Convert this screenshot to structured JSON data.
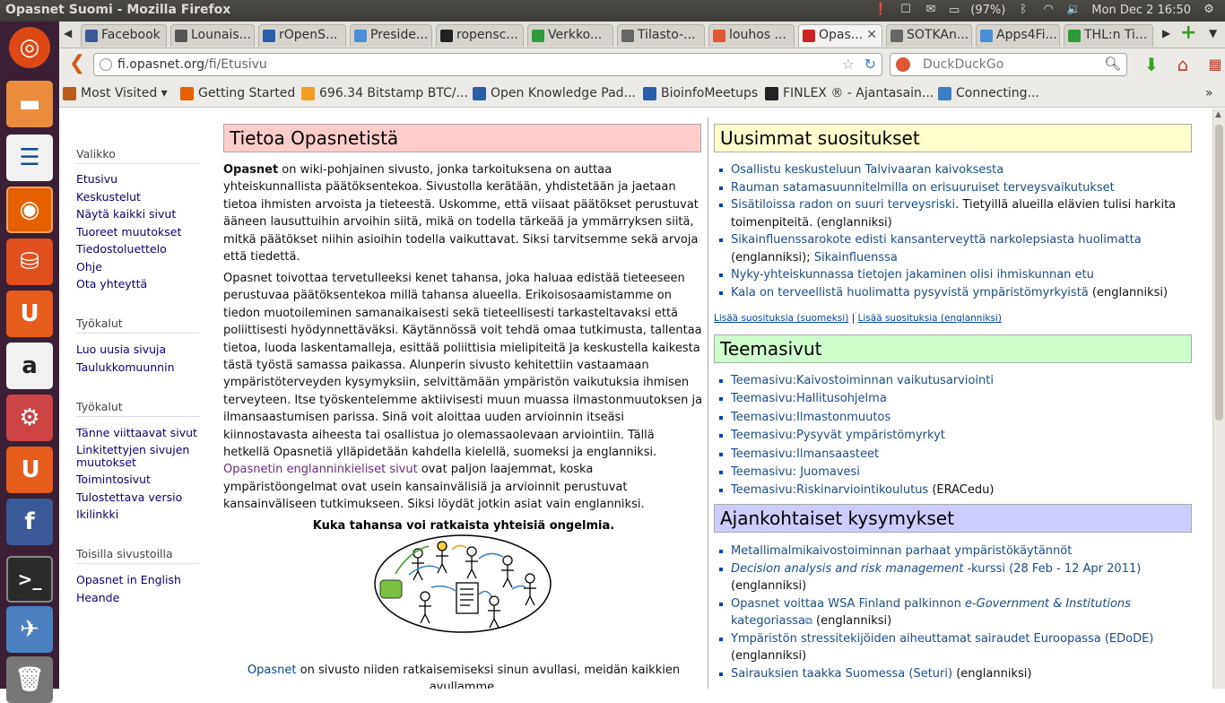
{
  "window": {
    "title": "Opasnet Suomi - Mozilla Firefox",
    "battery": "(97%)",
    "datetime": "Mon Dec 2  16:50"
  },
  "tabs": [
    {
      "label": "Facebook",
      "color": "#3b5998"
    },
    {
      "label": "Lounais...",
      "color": "#555555"
    },
    {
      "label": "rOpenS...",
      "color": "#2a5fa8"
    },
    {
      "label": "Preside...",
      "color": "#4a8fd6"
    },
    {
      "label": "ropensc...",
      "color": "#222222"
    },
    {
      "label": "Verkko...",
      "color": "#2f9a3a"
    },
    {
      "label": "Tilasto-...",
      "color": "#666666"
    },
    {
      "label": "louhos ...",
      "color": "#de5833"
    },
    {
      "label": "Opas...",
      "color": "#cc2222",
      "active": true
    },
    {
      "label": "SOTKAn...",
      "color": "#666666"
    },
    {
      "label": "Apps4Fi...",
      "color": "#4a8fd6"
    },
    {
      "label": "THL:n Ti...",
      "color": "#2f9a3a"
    }
  ],
  "navbar": {
    "url_host": "fi.opasnet.org",
    "url_path": "/fi/Etusivu",
    "search_placeholder": "DuckDuckGo"
  },
  "bookmarks": [
    {
      "label": "Most Visited ▾",
      "color": "#b85c1f"
    },
    {
      "label": "Getting Started",
      "color": "#e66000"
    },
    {
      "label": "696.34 Bitstamp BTC/...",
      "color": "#f0a020"
    },
    {
      "label": "Open Knowledge Pad...",
      "color": "#2a5fa8"
    },
    {
      "label": "BioinfoMeetups",
      "color": "#2a5fa8"
    },
    {
      "label": "FINLEX ® - Ajantasain...",
      "color": "#222222"
    },
    {
      "label": "Connecting...",
      "color": "#3b7fc4"
    }
  ],
  "sidebar": {
    "section1": {
      "heading": "Valikko",
      "links": [
        "Etusivu",
        "Keskustelut",
        "Näytä kaikki sivut",
        "Tuoreet muutokset",
        "Tiedostoluettelo",
        "Ohje",
        "Ota yhteyttä"
      ]
    },
    "section2": {
      "heading": "Työkalut",
      "links": [
        "Luo uusia sivuja",
        "Taulukkomuunnin"
      ]
    },
    "section3": {
      "heading": "Työkalut",
      "links": [
        "Tänne viittaavat sivut",
        "Linkitettyjen sivujen",
        "muutokset",
        "Toimintosivut",
        "Tulostettava versio",
        "Ikilinkki"
      ]
    },
    "section4": {
      "heading": "Toisilla sivustoilla",
      "links": [
        "Opasnet in English",
        "Heande"
      ]
    }
  },
  "left": {
    "heading": "Tietoa Opasnetistä",
    "p1_bold": "Opasnet",
    "p1_rest": " on wiki-pohjainen sivusto, jonka tarkoituksena on auttaa yhteiskunnallista päätöksentekoa. Sivustolla kerätään, yhdistetään ja jaetaan tietoa ihmisten arvoista ja tieteestä. Uskomme, että viisaat päätökset perustuvat ääneen lausuttuihin arvoihin siitä, mikä on todella tärkeää ja ymmärryksen siitä, mitkä päätökset niihin asioihin todella vaikuttavat. Siksi tarvitsemme sekä arvoja että tiedettä.",
    "p2_text": "Opasnet toivottaa tervetulleeksi kenet tahansa, joka haluaa edistää tieteeseen perustuvaa päätöksentekoa millä tahansa alueella. Erikoisosaamistamme on tiedon muotoileminen samanaikaisesti sekä tieteellisesti tarkasteltavaksi että poliittisesti hyödynnettäväksi. Käytännössä voit tehdä omaa tutkimusta, tallentaa tietoa, luoda laskentamalleja, esittää poliittisia mielipiteitä ja keskustella kaikesta tästä työstä samassa paikassa. Alunperin sivusto kehitettiin vastaamaan ympäristöterveyden kysymyksiin, selvittämään ympäristön vaikutuksia ihmisen terveyteen. Itse työskentelemme aktiivisesti muun muassa ilmastonmuutoksen ja ilmansaastumisen parissa. Sinä voit aloittaa uuden arvioinnin itseäsi kiinnostavasta aiheesta tai osallistua jo olemassaolevaan arviointiin. Tällä hetkellä Opasnetiä ylläpidetään kahdella kielellä, suomeksi ja englanniksi.",
    "p2_link": "Opasnetin englanninkieliset sivut",
    "p2_tail": " ovat paljon laajemmat, koska ympäristöongelmat ovat usein kansainvälisiä ja arvioinnit perustuvat kansainväliseen tutkimukseen. Siksi löydät jotkin asiat vain englanniksi.",
    "figure_caption": "Kuka tahansa voi ratkaista yhteisiä ongelmia.",
    "bottom_link": "Opasnet",
    "bottom_text": " on sivusto niiden ratkaisemiseksi sinun avullasi, meidän kaikkien avullamme."
  },
  "right": {
    "box1": {
      "heading": "Uusimmat suositukset",
      "color": "#ffffcc",
      "items": [
        {
          "link": "Osallistu keskusteluun Talvivaaran kaivoksesta",
          "tail": ""
        },
        {
          "link": "Rauman satamasuunnitelmilla on erisuuruiset terveysvaikutukset",
          "tail": ""
        },
        {
          "link": "Sisätiloissa radon on suuri terveysriski",
          "tail": ". Tietyillä alueilla elävien tulisi harkita toimenpiteitä. (englanniksi)"
        },
        {
          "link": "Sikainfluenssarokote edisti kansanterveyttä narkolepsiasta huolimatta",
          "tail": " (englanniksi); ",
          "link2": "Sikainfluenssa"
        },
        {
          "link": "Nyky-yhteiskunnassa tietojen jakaminen olisi ihmiskunnan etu",
          "tail": ""
        },
        {
          "link": "Kala on terveellistä huolimatta pysyvistä ympäristömyrkyistä",
          "tail": " (englanniksi)"
        }
      ],
      "more1": "Lisää suosituksia (suomeksi)",
      "sep": " | ",
      "more2": "Lisää suosituksia (englanniksi)"
    },
    "box2": {
      "heading": "Teemasivut",
      "color": "#ccffcc",
      "items": [
        {
          "link": "Teemasivu:Kaivostoiminnan vaikutusarviointi",
          "tail": ""
        },
        {
          "link": "Teemasivu:Hallitusohjelma",
          "tail": ""
        },
        {
          "link": "Teemasivu:Ilmastonmuutos",
          "tail": ""
        },
        {
          "link": "Teemasivu:Pysyvät ympäristömyrkyt",
          "tail": ""
        },
        {
          "link": "Teemasivu:Ilmansaasteet",
          "tail": ""
        },
        {
          "link": "Teemasivu: Juomavesi",
          "tail": ""
        },
        {
          "link": "Teemasivu:Riskinarviointikoulutus",
          "tail": " (ERACedu)"
        }
      ]
    },
    "box3": {
      "heading": "Ajankohtaiset kysymykset",
      "color": "#ccccff",
      "items": [
        {
          "link": "Metallimalmikaivostoiminnan parhaat ympäristökäytännöt",
          "tail": ""
        },
        {
          "link": "Decision analysis and risk management",
          "italic": true,
          "link_tail": " -kurssi (28 Feb - 12 Apr 2011)",
          "tail": " (englanniksi)"
        },
        {
          "link": "Opasnet voittaa WSA Finland palkinnon ",
          "link_italic": "e-Government & Institutions",
          "link_tail": " kategoriassa",
          "ext": "⧉",
          "tail": " (englanniksi)"
        },
        {
          "link": "Ympäristön stressitekijöiden aiheuttamat sairaudet Euroopassa (EDoDE)",
          "tail": " (englanniksi)"
        },
        {
          "link": "Sairauksien taakka Suomessa (Seturi)",
          "tail": " (englanniksi)"
        }
      ]
    }
  }
}
